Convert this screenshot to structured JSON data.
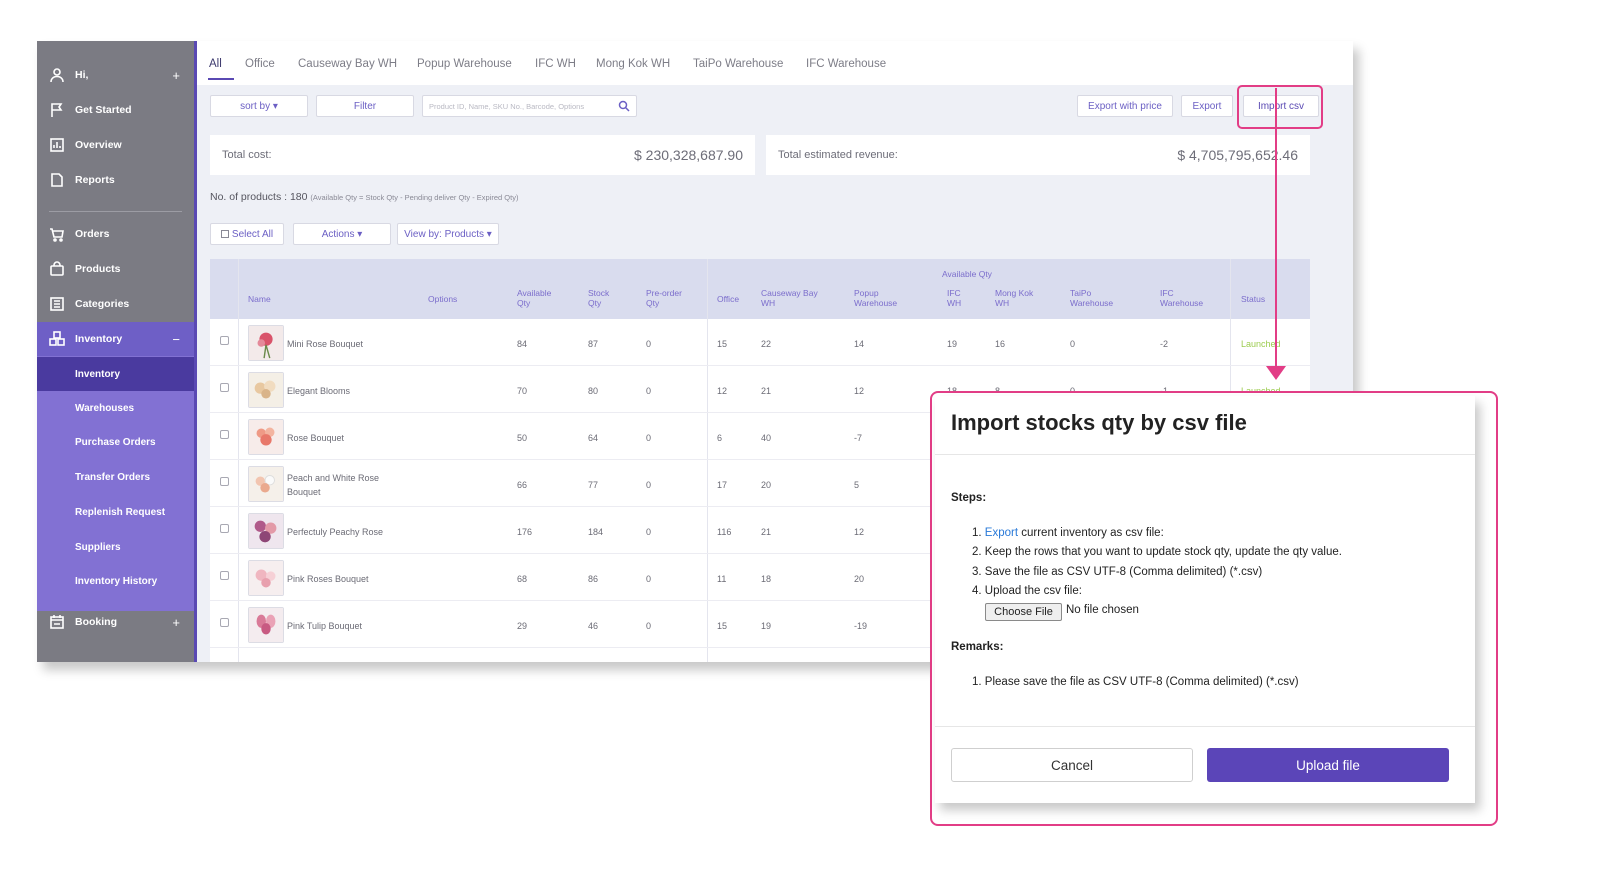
{
  "sidebar": {
    "greeting": "Hi,",
    "items": [
      {
        "label": "Get Started",
        "icon": "flag-icon"
      },
      {
        "label": "Overview",
        "icon": "chart-icon"
      },
      {
        "label": "Reports",
        "icon": "document-icon"
      },
      {
        "label": "Orders",
        "icon": "cart-icon"
      },
      {
        "label": "Products",
        "icon": "bag-icon"
      },
      {
        "label": "Categories",
        "icon": "list-icon"
      },
      {
        "label": "Inventory",
        "icon": "boxes-icon"
      }
    ],
    "inventory_sub": [
      "Inventory",
      "Warehouses",
      "Purchase Orders",
      "Transfer Orders",
      "Replenish Request",
      "Suppliers",
      "Inventory History"
    ],
    "booking": "Booking"
  },
  "tabs": [
    "All",
    "Office",
    "Causeway Bay WH",
    "Popup Warehouse",
    "IFC WH",
    "Mong Kok WH",
    "TaiPo Warehouse",
    "IFC Warehouse"
  ],
  "toolbar": {
    "sort_by": "sort by ▾",
    "filter": "Filter",
    "search_placeholder": "Product ID, Name, SKU No., Barcode, Options",
    "export_with_price": "Export with price",
    "export": "Export",
    "import_csv": "Import csv"
  },
  "summary": {
    "total_cost_label": "Total cost:",
    "total_cost_value": "$ 230,328,687.90",
    "revenue_label": "Total estimated revenue:",
    "revenue_value": "$ 4,705,795,652.46"
  },
  "products_count": {
    "text": "No. of products : 180",
    "note": "(Available Qty = Stock Qty - Pending deliver Qty - Expired Qty)"
  },
  "actions": {
    "select_all": "Select All",
    "actions": "Actions ▾",
    "view_by": "View by: Products ▾"
  },
  "table": {
    "available_qty_group": "Available Qty",
    "headers": {
      "name": "Name",
      "options": "Options",
      "available": [
        "Available",
        "Qty"
      ],
      "stock": [
        "Stock",
        "Qty"
      ],
      "preorder": [
        "Pre-order",
        "Qty"
      ],
      "office": "Office",
      "causeway": [
        "Causeway Bay",
        "WH"
      ],
      "popup": [
        "Popup",
        "Warehouse"
      ],
      "ifcwh": [
        "IFC",
        "WH"
      ],
      "mongkok": [
        "Mong Kok",
        "WH"
      ],
      "taipo": [
        "TaiPo",
        "Warehouse"
      ],
      "ifcwarehouse": [
        "IFC",
        "Warehouse"
      ],
      "status": "Status"
    },
    "rows": [
      {
        "name": [
          "Mini Rose Bouquet"
        ],
        "available": "84",
        "stock": "87",
        "preorder": "0",
        "office": "15",
        "causeway": "22",
        "popup": "14",
        "ifcwh": "19",
        "mongkok": "16",
        "taipo": "0",
        "ifcwarehouse": "-2",
        "status": "Launched"
      },
      {
        "name": [
          "Elegant Blooms"
        ],
        "available": "70",
        "stock": "80",
        "preorder": "0",
        "office": "12",
        "causeway": "21",
        "popup": "12",
        "ifcwh": "18",
        "mongkok": "8",
        "taipo": "0",
        "ifcwarehouse": "-1",
        "status": "Launched"
      },
      {
        "name": [
          "Rose Bouquet"
        ],
        "available": "50",
        "stock": "64",
        "preorder": "0",
        "office": "6",
        "causeway": "40",
        "popup": "-7"
      },
      {
        "name": [
          "Peach and White Rose",
          "Bouquet"
        ],
        "available": "66",
        "stock": "77",
        "preorder": "0",
        "office": "17",
        "causeway": "20",
        "popup": "5"
      },
      {
        "name": [
          "Perfectuly Peachy Rose"
        ],
        "available": "176",
        "stock": "184",
        "preorder": "0",
        "office": "116",
        "causeway": "21",
        "popup": "12"
      },
      {
        "name": [
          "Pink Roses Bouquet"
        ],
        "available": "68",
        "stock": "86",
        "preorder": "0",
        "office": "11",
        "causeway": "18",
        "popup": "20"
      },
      {
        "name": [
          "Pink Tulip Bouquet"
        ],
        "available": "29",
        "stock": "46",
        "preorder": "0",
        "office": "15",
        "causeway": "19",
        "popup": "-19"
      }
    ]
  },
  "modal": {
    "title": "Import stocks qty by csv file",
    "steps_label": "Steps:",
    "steps": [
      {
        "num": "1.",
        "link": "Export",
        "text": " current inventory as csv file:"
      },
      {
        "num": "2.",
        "text": "Keep the rows that you want to update stock qty, update the qty value."
      },
      {
        "num": "3.",
        "text": "Save the file as CSV UTF-8 (Comma delimited) (*.csv)"
      },
      {
        "num": "4.",
        "text": "Upload the csv file:"
      }
    ],
    "choose_file": "Choose File",
    "no_file": "No file chosen",
    "remarks_label": "Remarks:",
    "remarks": [
      {
        "num": "1.",
        "text": "Please save the file as CSV UTF-8 (Comma delimited) (*.csv)"
      }
    ],
    "cancel": "Cancel",
    "upload": "Upload file"
  },
  "colors": {
    "accent": "#5a49b3",
    "highlight": "#e23d86",
    "sidebar": "#7b7b83",
    "launched": "#9ccc4f"
  }
}
